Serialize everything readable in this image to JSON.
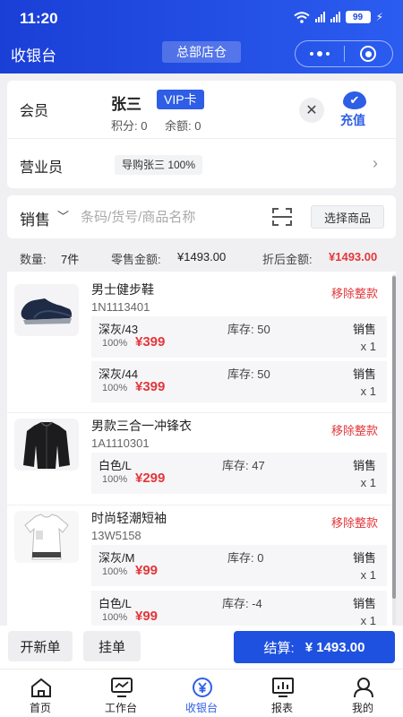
{
  "status_bar": {
    "time": "11:20",
    "battery": "99"
  },
  "header": {
    "title": "收银台",
    "store": "总部店仓"
  },
  "member": {
    "label": "会员",
    "name": "张三",
    "level": "VIP卡",
    "points": "积分: 0",
    "balance": "余额: 0",
    "close_icon": "close-icon",
    "recharge_label": "充值"
  },
  "salesperson": {
    "label": "营业员",
    "value": "导购张三 100%"
  },
  "search": {
    "mode": "销售",
    "placeholder": "条码/货号/商品名称",
    "select_label": "选择商品"
  },
  "summary": {
    "qty_label": "数量:",
    "qty_value": "7件",
    "retail_label": "零售金额:",
    "retail_value": "¥1493.00",
    "discount_label": "折后金额:",
    "discount_value": "¥1493.00"
  },
  "products": [
    {
      "name": "男士健步鞋",
      "code": "1N1113401",
      "remove": "移除整款",
      "image": "shoe-image",
      "skus": [
        {
          "attr": "深灰/43",
          "stock": "库存: 50",
          "type": "销售",
          "discount": "100%",
          "price": "¥399",
          "qty": "x 1"
        },
        {
          "attr": "深灰/44",
          "stock": "库存: 50",
          "type": "销售",
          "discount": "100%",
          "price": "¥399",
          "qty": "x 1"
        }
      ]
    },
    {
      "name": "男款三合一冲锋衣",
      "code": "1A1110301",
      "remove": "移除整款",
      "image": "jacket-image",
      "skus": [
        {
          "attr": "白色/L",
          "stock": "库存: 47",
          "type": "销售",
          "discount": "100%",
          "price": "¥299",
          "qty": "x 1"
        }
      ]
    },
    {
      "name": "时尚轻潮短袖",
      "code": "13W5158",
      "remove": "移除整款",
      "image": "shirt-image",
      "skus": [
        {
          "attr": "深灰/M",
          "stock": "库存: 0",
          "type": "销售",
          "discount": "100%",
          "price": "¥99",
          "qty": "x 1"
        },
        {
          "attr": "白色/L",
          "stock": "库存: -4",
          "type": "销售",
          "discount": "100%",
          "price": "¥99",
          "qty": "x 1"
        }
      ]
    }
  ],
  "actions": {
    "new_order": "开新单",
    "hold": "挂单",
    "checkout_label": "结算:",
    "checkout_total": "¥ 1493.00"
  },
  "tabs": [
    {
      "label": "首页",
      "icon": "home-icon"
    },
    {
      "label": "工作台",
      "icon": "monitor-icon"
    },
    {
      "label": "收银台",
      "icon": "yen-icon",
      "active": true
    },
    {
      "label": "报表",
      "icon": "chart-icon"
    },
    {
      "label": "我的",
      "icon": "user-icon"
    }
  ],
  "colors": {
    "primary": "#1f51e0",
    "price_red": "#e3373b"
  }
}
